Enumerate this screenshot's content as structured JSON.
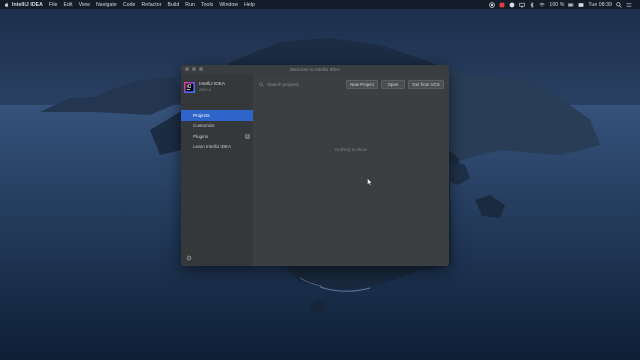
{
  "menubar": {
    "items": [
      "IntelliJ IDEA",
      "File",
      "Edit",
      "View",
      "Navigate",
      "Code",
      "Refactor",
      "Build",
      "Run",
      "Tools",
      "Window",
      "Help"
    ],
    "battery": "100 %",
    "clock": "Tue 08:39"
  },
  "window": {
    "title": "Welcome to IntelliJ IDEA",
    "brand": {
      "name": "IntelliJ IDEA",
      "version": "2020.3"
    },
    "nav": [
      {
        "label": "Projects",
        "active": true
      },
      {
        "label": "Customize",
        "active": false
      },
      {
        "label": "Plugins",
        "active": false,
        "badge": "1"
      },
      {
        "label": "Learn IntelliJ IDEA",
        "active": false
      }
    ],
    "search": {
      "placeholder": "Search projects",
      "value": ""
    },
    "buttons": {
      "new_project": "New Project",
      "open": "Open",
      "get_from_vcs": "Get from VCS"
    },
    "empty_text": "Nothing to show"
  },
  "colors": {
    "accent": "#2f65ca",
    "window_bg": "#3c3f41",
    "sidebar_bg": "#35383a"
  },
  "icons": [
    "apple-logo-icon",
    "intellij-logo-icon",
    "search-icon",
    "gear-icon",
    "mouse-cursor-icon"
  ]
}
